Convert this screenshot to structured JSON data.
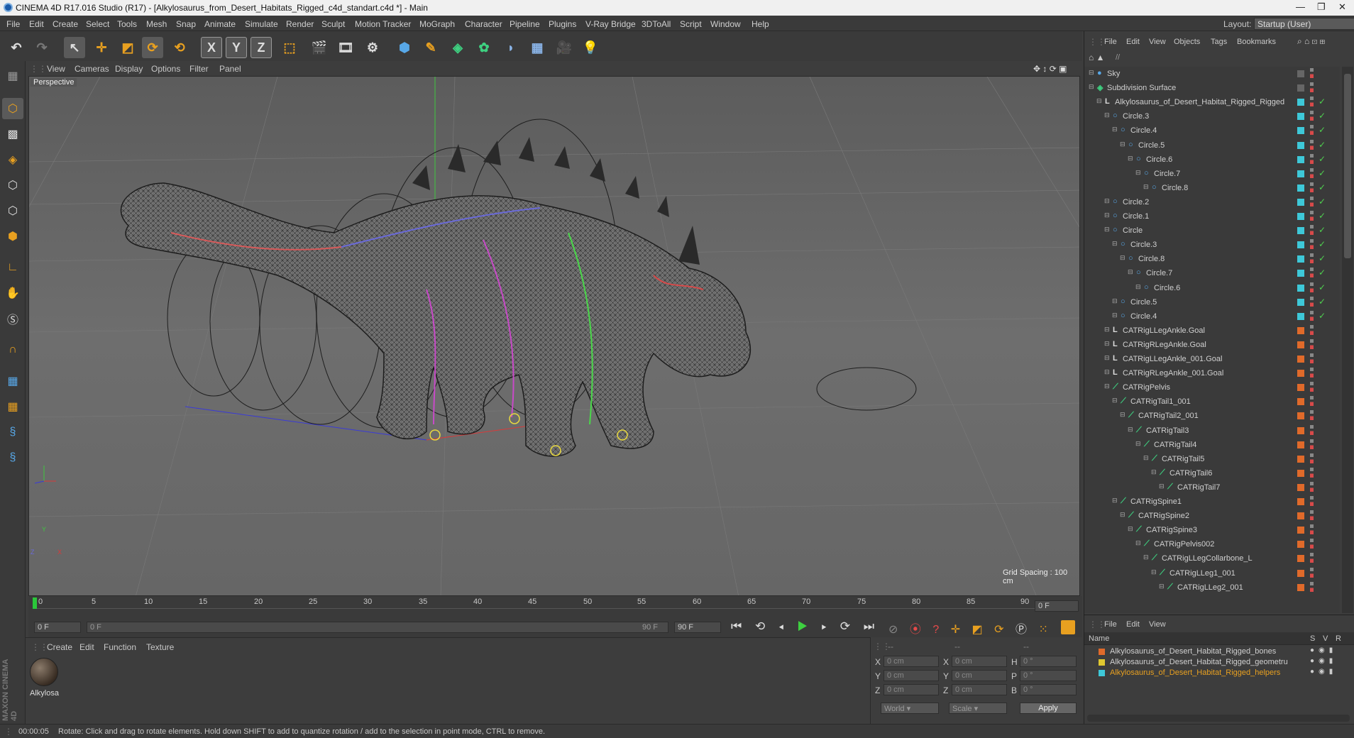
{
  "app": {
    "title": "CINEMA 4D R17.016 Studio (R17) - [Alkylosaurus_from_Desert_Habitats_Rigged_c4d_standart.c4d *] - Main",
    "window_controls": [
      "—",
      "❐",
      "✕"
    ]
  },
  "menubar": {
    "items": [
      "File",
      "Edit",
      "Create",
      "Select",
      "Tools",
      "Mesh",
      "Snap",
      "Animate",
      "Simulate",
      "Render",
      "Sculpt",
      "Motion Tracker",
      "MoGraph",
      "Character",
      "Pipeline",
      "Plugins",
      "V-Ray Bridge",
      "3DToAll",
      "Script",
      "Window",
      "Help"
    ],
    "layout_label": "Layout:",
    "layout_value": "Startup (User)"
  },
  "viewport": {
    "menu": [
      "View",
      "Cameras",
      "Display",
      "Options",
      "Filter",
      "Panel"
    ],
    "camera_label": "Perspective",
    "grid_spacing": "Grid Spacing : 100 cm",
    "axis_labels": [
      "Y",
      "Z",
      "X"
    ]
  },
  "timeline": {
    "ticks": [
      "0",
      "5",
      "10",
      "15",
      "20",
      "25",
      "30",
      "35",
      "40",
      "45",
      "50",
      "55",
      "60",
      "65",
      "70",
      "75",
      "80",
      "85",
      "90"
    ],
    "current_frame": "0 F"
  },
  "transport": {
    "start_frame": "0 F",
    "range_start": "0 F",
    "range_end": "90 F",
    "end_frame": "90 F"
  },
  "material_panel": {
    "menu": [
      "Create",
      "Edit",
      "Function",
      "Texture"
    ],
    "material_name": "Alkylosa"
  },
  "coord_panel": {
    "headers": [
      "--",
      "--",
      "--"
    ],
    "rows": [
      {
        "a": "X",
        "av": "0 cm",
        "b": "X",
        "bv": "0 cm",
        "c": "H",
        "cv": "0 °"
      },
      {
        "a": "Y",
        "av": "0 cm",
        "b": "Y",
        "bv": "0 cm",
        "c": "P",
        "cv": "0 °"
      },
      {
        "a": "Z",
        "av": "0 cm",
        "b": "Z",
        "bv": "0 cm",
        "c": "B",
        "cv": "0 °"
      }
    ],
    "world": "World",
    "scale": "Scale",
    "apply": "Apply"
  },
  "object_manager": {
    "menu": [
      "File",
      "Edit",
      "View",
      "Objects",
      "Tags",
      "Bookmarks"
    ],
    "path": "//",
    "rows": [
      {
        "name": "Sky",
        "depth": 0,
        "icon": "sky",
        "tag": "none"
      },
      {
        "name": "Subdivision Surface",
        "depth": 0,
        "icon": "subd",
        "tag": "none"
      },
      {
        "name": "Alkylosaurus_of_Desert_Habitat_Rigged_Rigged",
        "depth": 1,
        "icon": "null",
        "tag": "cyan"
      },
      {
        "name": "Circle.3",
        "depth": 2,
        "icon": "circle",
        "tag": "cyan"
      },
      {
        "name": "Circle.4",
        "depth": 3,
        "icon": "circle",
        "tag": "cyan"
      },
      {
        "name": "Circle.5",
        "depth": 4,
        "icon": "circle",
        "tag": "cyan"
      },
      {
        "name": "Circle.6",
        "depth": 5,
        "icon": "circle",
        "tag": "cyan"
      },
      {
        "name": "Circle.7",
        "depth": 6,
        "icon": "circle",
        "tag": "cyan"
      },
      {
        "name": "Circle.8",
        "depth": 7,
        "icon": "circle",
        "tag": "cyan"
      },
      {
        "name": "Circle.2",
        "depth": 2,
        "icon": "circle",
        "tag": "cyan"
      },
      {
        "name": "Circle.1",
        "depth": 2,
        "icon": "circle",
        "tag": "cyan"
      },
      {
        "name": "Circle",
        "depth": 2,
        "icon": "circle",
        "tag": "cyan"
      },
      {
        "name": "Circle.3",
        "depth": 3,
        "icon": "circle",
        "tag": "cyan"
      },
      {
        "name": "Circle.8",
        "depth": 4,
        "icon": "circle",
        "tag": "cyan"
      },
      {
        "name": "Circle.7",
        "depth": 5,
        "icon": "circle",
        "tag": "cyan"
      },
      {
        "name": "Circle.6",
        "depth": 6,
        "icon": "circle",
        "tag": "cyan"
      },
      {
        "name": "Circle.5",
        "depth": 3,
        "icon": "circle",
        "tag": "cyan"
      },
      {
        "name": "Circle.4",
        "depth": 3,
        "icon": "circle",
        "tag": "cyan"
      },
      {
        "name": "CATRigLLegAnkle.Goal",
        "depth": 2,
        "icon": "null",
        "tag": "orange"
      },
      {
        "name": "CATRigRLegAnkle.Goal",
        "depth": 2,
        "icon": "null",
        "tag": "orange"
      },
      {
        "name": "CATRigLLegAnkle_001.Goal",
        "depth": 2,
        "icon": "null",
        "tag": "orange"
      },
      {
        "name": "CATRigRLegAnkle_001.Goal",
        "depth": 2,
        "icon": "null",
        "tag": "orange"
      },
      {
        "name": "CATRigPelvis",
        "depth": 2,
        "icon": "bone",
        "tag": "orange"
      },
      {
        "name": "CATRigTail1_001",
        "depth": 3,
        "icon": "bone",
        "tag": "orange"
      },
      {
        "name": "CATRigTail2_001",
        "depth": 4,
        "icon": "bone",
        "tag": "orange"
      },
      {
        "name": "CATRigTail3",
        "depth": 5,
        "icon": "bone",
        "tag": "orange"
      },
      {
        "name": "CATRigTail4",
        "depth": 6,
        "icon": "bone",
        "tag": "orange"
      },
      {
        "name": "CATRigTail5",
        "depth": 7,
        "icon": "bone",
        "tag": "orange"
      },
      {
        "name": "CATRigTail6",
        "depth": 8,
        "icon": "bone",
        "tag": "orange"
      },
      {
        "name": "CATRigTail7",
        "depth": 9,
        "icon": "bone",
        "tag": "orange"
      },
      {
        "name": "CATRigSpine1",
        "depth": 3,
        "icon": "bone",
        "tag": "orange"
      },
      {
        "name": "CATRigSpine2",
        "depth": 4,
        "icon": "bone",
        "tag": "orange"
      },
      {
        "name": "CATRigSpine3",
        "depth": 5,
        "icon": "bone",
        "tag": "orange"
      },
      {
        "name": "CATRigPelvis002",
        "depth": 6,
        "icon": "bone",
        "tag": "orange"
      },
      {
        "name": "CATRigLLegCollarbone_L",
        "depth": 7,
        "icon": "bone",
        "tag": "orange"
      },
      {
        "name": "CATRigLLeg1_001",
        "depth": 8,
        "icon": "bone",
        "tag": "orange"
      },
      {
        "name": "CATRigLLeg2_001",
        "depth": 9,
        "icon": "bone",
        "tag": "orange"
      }
    ]
  },
  "layer_panel": {
    "menu": [
      "File",
      "Edit",
      "View"
    ],
    "header_name": "Name",
    "header_cols": [
      "S",
      "V",
      "R"
    ],
    "layers": [
      {
        "name": "Alkylosaurus_of_Desert_Habitat_Rigged_bones",
        "color": "#e06a2a",
        "active": false
      },
      {
        "name": "Alkylosaurus_of_Desert_Habitat_Rigged_geometru",
        "color": "#e0c830",
        "active": false
      },
      {
        "name": "Alkylosaurus_of_Desert_Habitat_Rigged_helpers",
        "color": "#3ec8d8",
        "active": true
      }
    ]
  },
  "status": {
    "time": "00:00:05",
    "message": "Rotate: Click and drag to rotate elements. Hold down SHIFT to add to quantize rotation / add to the selection in point mode, CTRL to remove."
  },
  "colors": {
    "accent_orange": "#e8a020",
    "tag_cyan": "#3ec8d8",
    "tag_orange": "#e06a2a",
    "check_green": "#4fd04f"
  }
}
